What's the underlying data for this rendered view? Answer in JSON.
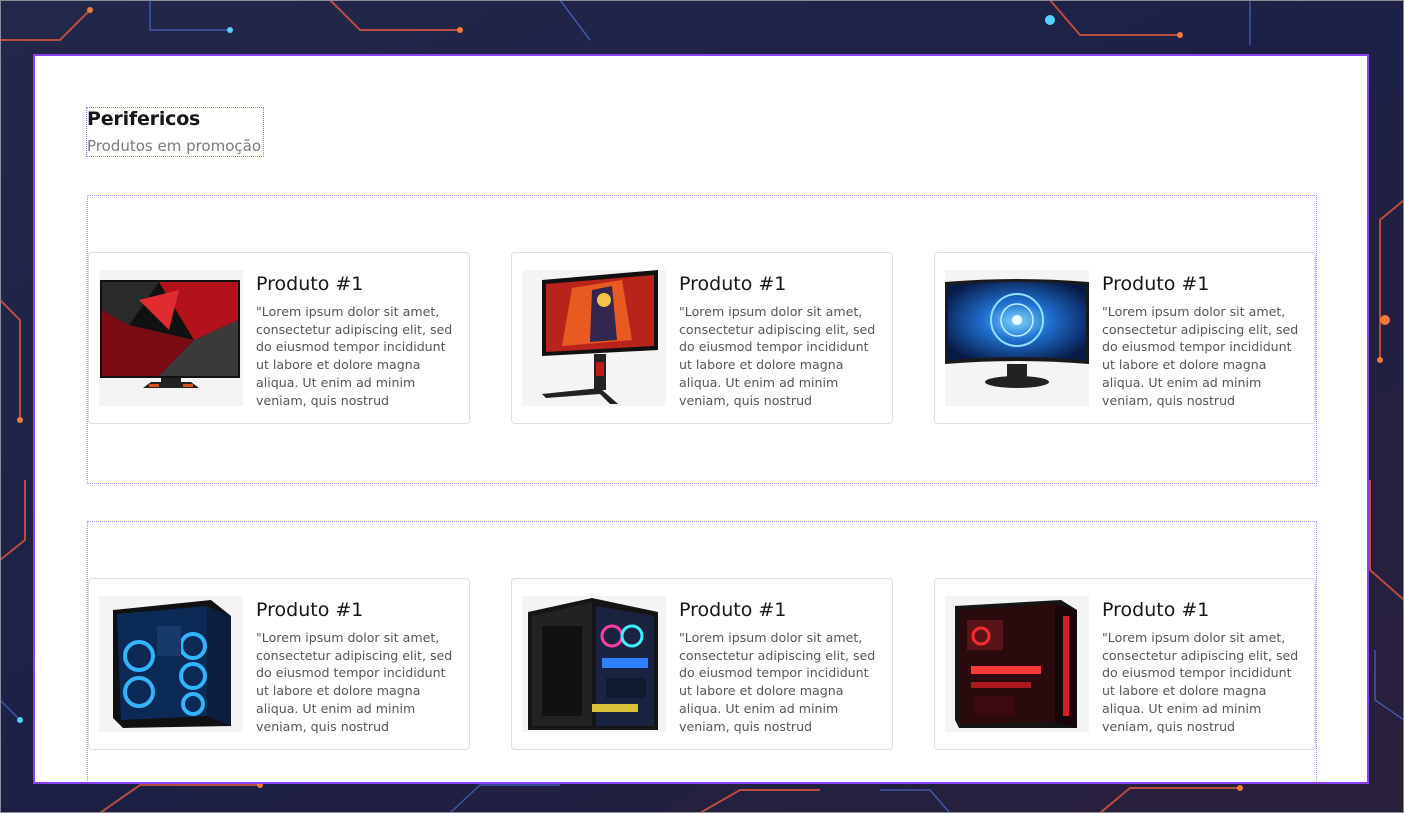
{
  "colors": {
    "accent": "#8a3ff0",
    "title": "#15151a",
    "muted": "#7a7a82",
    "backdrop": "#1a1f3a"
  },
  "section": {
    "title": "Perifericos",
    "subtitle": "Produtos em promoção"
  },
  "rows": [
    {
      "cards": [
        {
          "title": "Produto #1",
          "description": "\"Lorem ipsum dolor sit amet, consectetur adipiscing elit, sed do eiusmod tempor incididunt ut labore et dolore magna aliqua. Ut enim ad minim veniam, quis nostrud exercitation ullamco",
          "image": "monitor-red-abstract"
        },
        {
          "title": "Produto #1",
          "description": "\"Lorem ipsum dolor sit amet, consectetur adipiscing elit, sed do eiusmod tempor incididunt ut labore et dolore magna aliqua. Ut enim ad minim veniam, quis nostrud exercitation ullamco",
          "image": "monitor-gaming-stand"
        },
        {
          "title": "Produto #1",
          "description": "\"Lorem ipsum dolor sit amet, consectetur adipiscing elit, sed do eiusmod tempor incididunt ut labore et dolore magna aliqua. Ut enim ad minim veniam, quis nostrud exercitation ullamco",
          "image": "monitor-curved-blue"
        }
      ]
    },
    {
      "cards": [
        {
          "title": "Produto #1",
          "description": "\"Lorem ipsum dolor sit amet, consectetur adipiscing elit, sed do eiusmod tempor incididunt ut labore et dolore magna aliqua. Ut enim ad minim veniam, quis nostrud exercitation ullamco",
          "image": "pc-case-blue-fans"
        },
        {
          "title": "Produto #1",
          "description": "\"Lorem ipsum dolor sit amet, consectetur adipiscing elit, sed do eiusmod tempor incididunt ut labore et dolore magna aliqua. Ut enim ad minim veniam, quis nostrud exercitation ullamco",
          "image": "pc-case-rgb"
        },
        {
          "title": "Produto #1",
          "description": "\"Lorem ipsum dolor sit amet, consectetur adipiscing elit, sed do eiusmod tempor incididunt ut labore et dolore magna aliqua. Ut enim ad minim veniam, quis nostrud exercitation ullamco",
          "image": "pc-case-red"
        }
      ]
    }
  ]
}
